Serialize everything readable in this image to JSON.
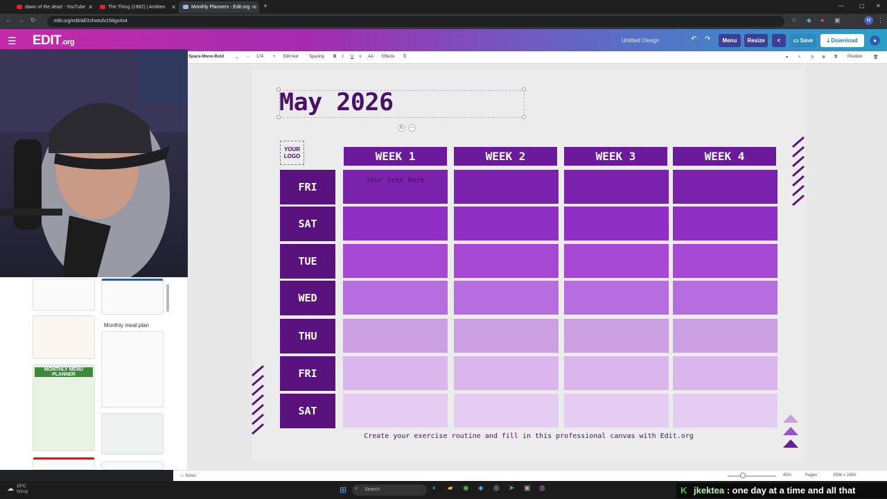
{
  "browser": {
    "tabs": [
      {
        "label": "dawn of the dead - YouTube",
        "color": "#e22"
      },
      {
        "label": "The Thing (1982) | Ambien",
        "color": "#e22"
      },
      {
        "label": "Monthly Planners - Edit.org - c",
        "color": "#9bd"
      }
    ],
    "url": "edit.org/edit/all/2chwtufx158go4s4"
  },
  "app": {
    "logo_main": "EDIT",
    "logo_suffix": ".org",
    "design_name": "Untitled Design",
    "menu_label": "Menu",
    "resize_label": "Resize",
    "save_label": "Save",
    "download_label": "Download",
    "user_initial": "M"
  },
  "toolbar": {
    "font_name": "Space-Mono-Bold",
    "font_size": "174",
    "edit_text": "Edit text",
    "spacing": "Spacing",
    "bold": "B",
    "italic": "I",
    "underline": "U",
    "case": "AA",
    "effects": "Effects",
    "position": "Position"
  },
  "templates": {
    "meal_plan_title": "Monthly meal plan",
    "menu_planner_title": "MONTHLY MENU PLANNER"
  },
  "planner": {
    "title": "May 2026",
    "logo_placeholder_line1": "YOUR",
    "logo_placeholder_line2": "LOGO",
    "weeks": [
      "WEEK 1",
      "WEEK 2",
      "WEEK 3",
      "WEEK 4"
    ],
    "days": [
      "FRI",
      "SAT",
      "TUE",
      "WED",
      "THU",
      "FRI",
      "SAT"
    ],
    "cell_text": "Your text here",
    "footer": "Create your exercise routine and fill in this professional canvas with Edit.org",
    "row_colors": [
      "#7a22ad",
      "#8f2fc4",
      "#a748d5",
      "#b76ce0",
      "#cc9fe2",
      "#d9b6ec",
      "#e4ccf2"
    ],
    "accent_color": "#6a1a9a",
    "day_color": "#5a127e"
  },
  "bottom": {
    "notes_label": "Notes",
    "zoom": "45%",
    "pages_label": "Pages",
    "dimensions": "3508 x 2480"
  },
  "taskbar": {
    "weather_temp": "15°C",
    "weather_text": "Windy",
    "search_placeholder": "Search"
  },
  "chat": {
    "user": "jkektea",
    "message": "one day at a time and all that"
  }
}
